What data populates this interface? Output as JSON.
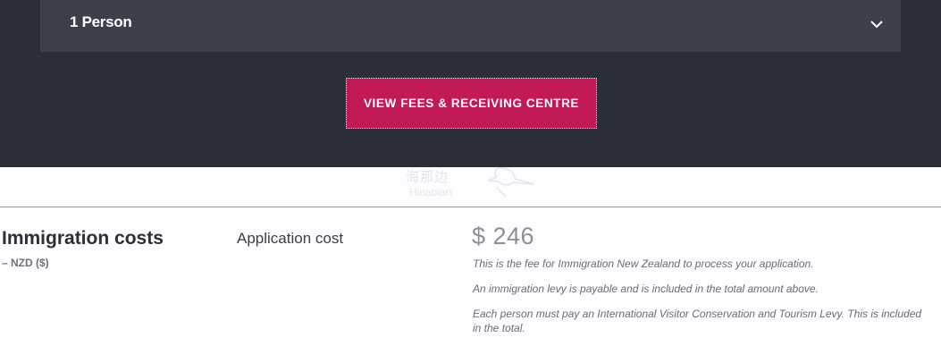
{
  "selector": {
    "value": "1 Person",
    "icon": "chevron-down-icon"
  },
  "cta": {
    "label": "VIEW FEES & RECEIVING CENTRE",
    "color": "#c21a57"
  },
  "watermark": {
    "text_cn": "海那边",
    "text_en": "Hinabian"
  },
  "costs": {
    "title": "Immigration costs",
    "currency": "– NZD ($)",
    "item_label": "Application cost",
    "amount": "$ 246",
    "notes": [
      "This is the fee for Immigration New Zealand to process your application.",
      "An immigration levy is payable and is included in the total amount above.",
      "Each person must pay an International Visitor Conservation and Tourism Levy. This is included in the total."
    ]
  },
  "colors": {
    "panel_bg": "#2b2d38",
    "select_bg": "#3d3f4d",
    "divider": "#41b4c8"
  }
}
